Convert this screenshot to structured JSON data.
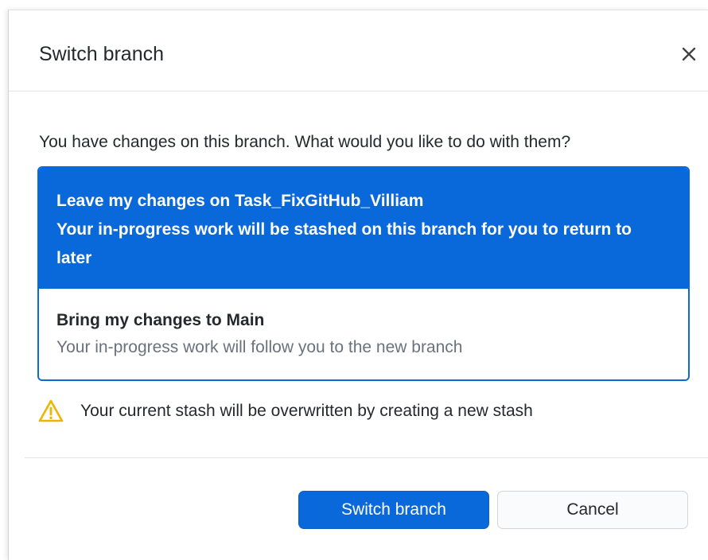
{
  "dialog": {
    "title": "Switch branch",
    "close_icon": "close-icon",
    "prompt": "You have changes on this branch. What would you like to do with them?",
    "options": [
      {
        "title": "Leave my changes on Task_FixGitHub_Villiam",
        "description": "Your in-progress work will be stashed on this branch for you to return to later",
        "selected": true
      },
      {
        "title": "Bring my changes to Main",
        "description": "Your in-progress work will follow you to the new branch",
        "selected": false
      }
    ],
    "warning": {
      "icon": "warning-icon",
      "text": "Your current stash will be overwritten by creating a new stash"
    },
    "buttons": {
      "primary": "Switch branch",
      "secondary": "Cancel"
    }
  },
  "colors": {
    "accent": "#0a69da",
    "warning": "#f0b400",
    "text": "#24292e",
    "muted": "#6a737d"
  }
}
